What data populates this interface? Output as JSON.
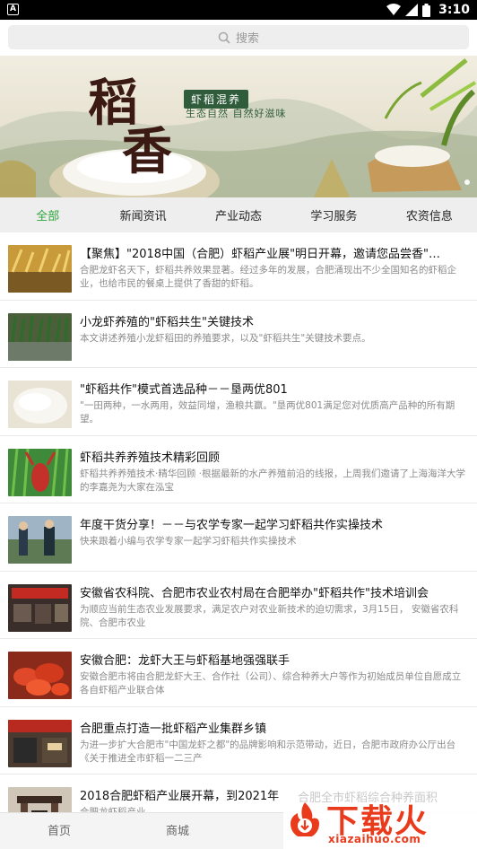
{
  "status_bar": {
    "app_icon": "A",
    "time": "3:10",
    "icons": [
      "wifi-icon",
      "signal-icon",
      "battery-icon"
    ]
  },
  "search": {
    "placeholder": "搜索",
    "icon": "search-icon"
  },
  "banner": {
    "char1": "稻",
    "char2": "香",
    "tag": "虾稻混养",
    "subtitle": "生态自然 自然好滋味"
  },
  "tabs": [
    {
      "label": "全部",
      "active": true
    },
    {
      "label": "新闻资讯",
      "active": false
    },
    {
      "label": "产业动态",
      "active": false
    },
    {
      "label": "学习服务",
      "active": false
    },
    {
      "label": "农资信息",
      "active": false
    }
  ],
  "articles": [
    {
      "title": "【聚焦】\"2018中国（合肥）虾稻产业展\"明日开幕，邀请您品尝香\"…",
      "desc": "合肥龙虾名天下，虾稻共养效果显著。经过多年的发展，合肥涌现出不少全国知名的虾稻企业，也给市民的餐桌上提供了香甜的虾稻。",
      "thumb": "rice-field"
    },
    {
      "title": "小龙虾养殖的\"虾稻共生\"关键技术",
      "desc": "本文讲述养殖小龙虾稻田的养殖要求，以及\"虾稻共生\"关键技术要点。",
      "thumb": "paddy"
    },
    {
      "title": "\"虾稻共作\"模式首选品种－－垦两优801",
      "desc": "\"一田两种，一水两用，效益同增，渔粮共赢。\"垦两优801满足您对优质高产品种的所有期望。",
      "thumb": "rice-grain"
    },
    {
      "title": "虾稻共养养殖技术精彩回顾",
      "desc": "虾稻共养养殖技术·精华回顾 ·根据最新的水产养殖前沿的线报，上周我们邀请了上海海洋大学的李嘉尧为大家在泓宝",
      "thumb": "crayfish-green"
    },
    {
      "title": "年度干货分享！－－与农学专家一起学习虾稻共作实操技术",
      "desc": "快来跟着小编与农学专家一起学习虾稻共作实操技术",
      "thumb": "people-field"
    },
    {
      "title": "安徽省农科院、合肥市农业农村局在合肥举办\"虾稻共作\"技术培训会",
      "desc": "为顺应当前生态农业发展要求，满足农户对农业新技术的迫切需求，3月15日， 安徽省农科院、合肥市农业",
      "thumb": "meeting"
    },
    {
      "title": "安徽合肥：龙虾大王与虾稻基地强强联手",
      "desc": "安徽合肥市将由合肥龙虾大王、合作社（公司）、综合种养大户等作为初始成员单位自愿成立各自虾稻产业联合体",
      "thumb": "crayfish-plate"
    },
    {
      "title": "合肥重点打造一批虾稻产业集群乡镇",
      "desc": "为进一步扩大合肥市\"中国龙虾之都\"的品牌影响和示范带动，近日，合肥市政府办公厅出台《关于推进全市虾稻一二三产",
      "thumb": "storefront"
    },
    {
      "title": "2018合肥虾稻产业展开幕，到2021年",
      "desc": "合肥龙虾稻产业",
      "thumb": "gate"
    }
  ],
  "bottom_nav": [
    {
      "label": "首页"
    },
    {
      "label": "商城"
    }
  ],
  "watermark": {
    "ghost_text": "合肥全市虾稻综合种养面积",
    "brand": "下载火",
    "site": "xiazaihuo.com"
  },
  "colors": {
    "accent": "#2fa33b",
    "brand_red": "#e93b1c"
  }
}
